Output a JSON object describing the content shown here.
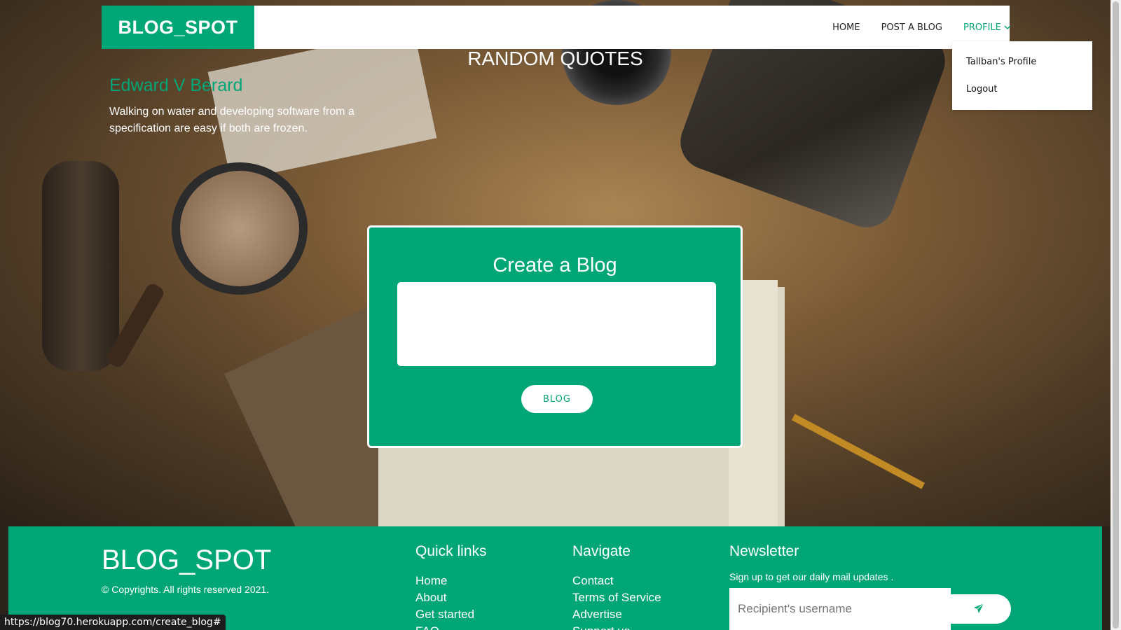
{
  "navbar": {
    "brand": "BLOG_SPOT",
    "links": [
      "HOME",
      "POST A BLOG"
    ],
    "profile_label": "PROFILE"
  },
  "profile_menu": {
    "items": [
      "Tallban's Profile",
      "Logout"
    ]
  },
  "quotes": {
    "title": "RANDOM QUOTES",
    "author": "Edward V Berard",
    "text": "Walking on water and developing software from a specification are easy if both are frozen."
  },
  "create_blog": {
    "title": "Create a Blog",
    "textarea_value": "",
    "button_label": "BLOG"
  },
  "footer": {
    "brand": "BLOG_SPOT",
    "copyright": "© Copyrights. All rights reserved 2021.",
    "quick_links": {
      "heading": "Quick links",
      "items": [
        "Home",
        "About",
        "Get started",
        "FAQ"
      ]
    },
    "navigate": {
      "heading": "Navigate",
      "items": [
        "Contact",
        "Terms of Service",
        "Advertise",
        "Support us"
      ]
    },
    "newsletter": {
      "heading": "Newsletter",
      "subtitle": "Sign up to get our daily mail updates .",
      "input_placeholder": "Recipient's username",
      "send_icon": "paper-plane-icon"
    }
  },
  "status_bar": {
    "url": "https://blog70.herokuapp.com/create_blog#"
  },
  "colors": {
    "accent": "#00a676",
    "white": "#ffffff"
  }
}
